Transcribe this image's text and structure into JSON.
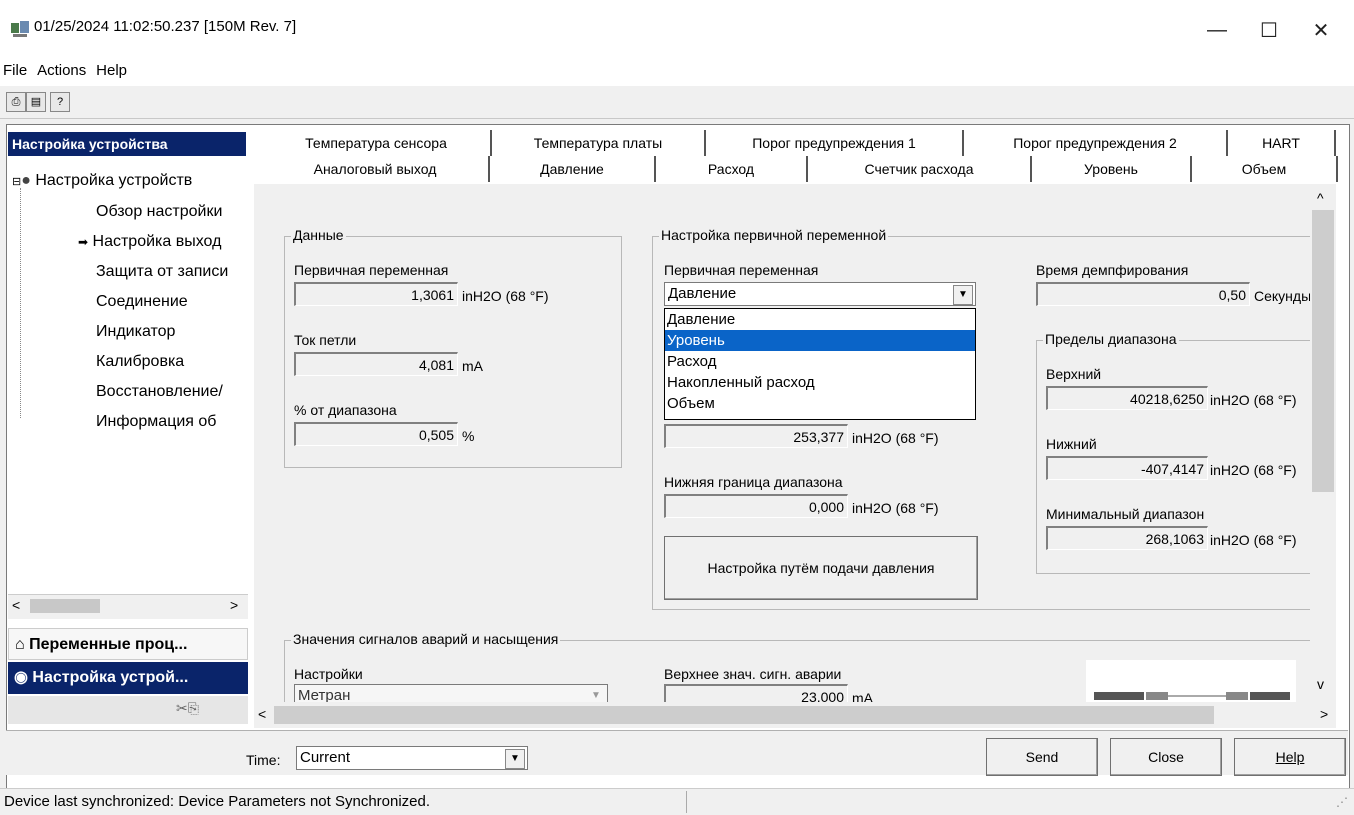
{
  "window": {
    "title": "01/25/2024 11:02:50.237 [150M Rev. 7]",
    "minimize": "—",
    "maximize": "☐",
    "close": "✕"
  },
  "menu": [
    "File",
    "Actions",
    "Help"
  ],
  "toolbar": {
    "print_icon": "print-icon",
    "preview_icon": "print-preview-icon",
    "help_icon": "context-help-icon"
  },
  "left_panel": {
    "header": "Настройка устройства",
    "tree_root": "Настройка устройств",
    "tree_items": [
      "Обзор настройки",
      "Настройка выход",
      "Защита от записи",
      "Соединение",
      "Индикатор",
      "Калибровка",
      "Восстановление/",
      "Информация об"
    ],
    "nav": [
      "Переменные проц...",
      "Настройка устрой..."
    ]
  },
  "tabs_row1": [
    "Температура сенсора",
    "Температура платы",
    "Порог предупреждения 1",
    "Порог предупреждения 2",
    "HART"
  ],
  "tabs_row2": [
    "Аналоговый выход",
    "Давление",
    "Расход",
    "Счетчик расхода",
    "Уровень",
    "Объем"
  ],
  "data_group": {
    "title": "Данные",
    "pv_label": "Первичная переменная",
    "pv_value": "1,3061",
    "pv_unit": "inH2O (68 °F)",
    "loop_label": "Ток петли",
    "loop_value": "4,081",
    "loop_unit": "mA",
    "pct_label": "% от диапазона",
    "pct_value": "0,505",
    "pct_unit": "%"
  },
  "pv_setup": {
    "title": "Настройка первичной переменной",
    "pv_label": "Первичная переменная",
    "pv_selected": "Давление",
    "dropdown_options": [
      "Давление",
      "Уровень",
      "Расход",
      "Накопленный расход",
      "Объем"
    ],
    "dropdown_highlight_index": 1,
    "upper_value": "253,377",
    "upper_unit": "inH2O (68 °F)",
    "lower_label": "Нижняя граница диапазона",
    "lower_value": "0,000",
    "lower_unit": "inH2O (68 °F)",
    "apply_pressure_button": "Настройка путём подачи давления",
    "damping_label": "Время демпфирования",
    "damping_value": "0,50",
    "damping_unit": "Секунды"
  },
  "limits": {
    "title": "Пределы диапазона",
    "upper_label": "Верхний",
    "upper_value": "40218,6250",
    "upper_unit": "inH2O (68 °F)",
    "lower_label": "Нижний",
    "lower_value": "-407,4147",
    "lower_unit": "inH2O (68 °F)",
    "min_label": "Минимальный диапазон",
    "min_value": "268,1063",
    "min_unit": "inH2O (68 °F)"
  },
  "alarm_group": {
    "title": "Значения сигналов аварий и насыщения",
    "settings_label": "Настройки",
    "settings_value": "Метран",
    "high_alarm_label": "Верхнее знач. сигн. аварии",
    "high_alarm_value": "23,000",
    "high_alarm_unit": "mA"
  },
  "bottom": {
    "time_label": "Time:",
    "time_value": "Current",
    "send": "Send",
    "close": "Close",
    "help": "Help"
  },
  "status": "Device last synchronized: Device Parameters not Synchronized."
}
